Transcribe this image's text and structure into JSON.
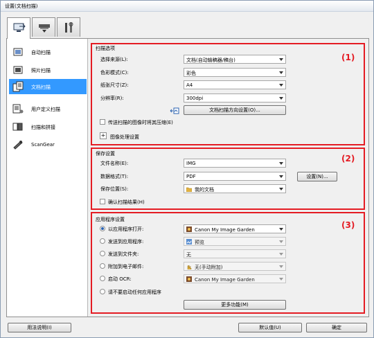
{
  "window": {
    "title": "设置(文档扫描)"
  },
  "tabs": [
    {
      "name": "scan-from-computer-tab",
      "icon": "computer-scan-icon"
    },
    {
      "name": "scan-from-panel-tab",
      "icon": "scanner-icon"
    },
    {
      "name": "general-settings-tab",
      "icon": "tools-icon"
    }
  ],
  "nav": [
    {
      "label": "自动扫描",
      "icon": "auto-scan-icon"
    },
    {
      "label": "照片扫描",
      "icon": "photo-scan-icon"
    },
    {
      "label": "文档扫描",
      "icon": "document-scan-icon",
      "selected": true
    },
    {
      "label": "用户定义扫描",
      "icon": "custom-scan-icon"
    },
    {
      "label": "扫描和拼接",
      "icon": "stitch-scan-icon"
    },
    {
      "label": "ScanGear",
      "icon": "scangear-icon"
    }
  ],
  "scan_options": {
    "title": "扫描选项",
    "source_label": "选择来源(L):",
    "source_value": "文档(自动输稿器/稿台)",
    "color_label": "色彩模式(C):",
    "color_value": "彩色",
    "paper_label": "纸张尺寸(Z):",
    "paper_value": "A4",
    "res_label": "分辨率(R):",
    "res_value": "300dpi",
    "orientation_button": "文档扫描方向设置(O)...",
    "compress_label": "传送扫描的图像时将其压缩(E)",
    "image_proc_label": "图像处理设置",
    "marker": "(1)"
  },
  "save_settings": {
    "title": "保存设置",
    "filename_label": "文件名称(E):",
    "filename_value": "IMG",
    "format_label": "数据格式(T):",
    "format_value": "PDF",
    "settings_button": "设置(N)...",
    "location_label": "保存位置(S):",
    "location_value": "我的文档",
    "confirm_label": "确认扫描结果(H)",
    "marker": "(2)"
  },
  "app_settings": {
    "title": "应用程序设置",
    "open_app_label": "以应用程序打开:",
    "open_app_value": "Canon My Image Garden",
    "send_app_label": "发送到应用程序:",
    "send_app_value": "预览",
    "send_folder_label": "发送到文件夹:",
    "send_folder_value": "无",
    "email_label": "附加到电子邮件:",
    "email_value": "无(手动附加)",
    "ocr_label": "启动 OCR:",
    "ocr_value": "Canon My Image Garden",
    "none_label": "请不要启动任何应用程序",
    "more_button": "更多功能(M)",
    "marker": "(3)"
  },
  "footer": {
    "help_button": "用法说明(I)",
    "defaults_button": "默认值(U)",
    "ok_button": "确定"
  },
  "colors": {
    "highlight": "#e41b23",
    "selection": "#3399ff"
  }
}
